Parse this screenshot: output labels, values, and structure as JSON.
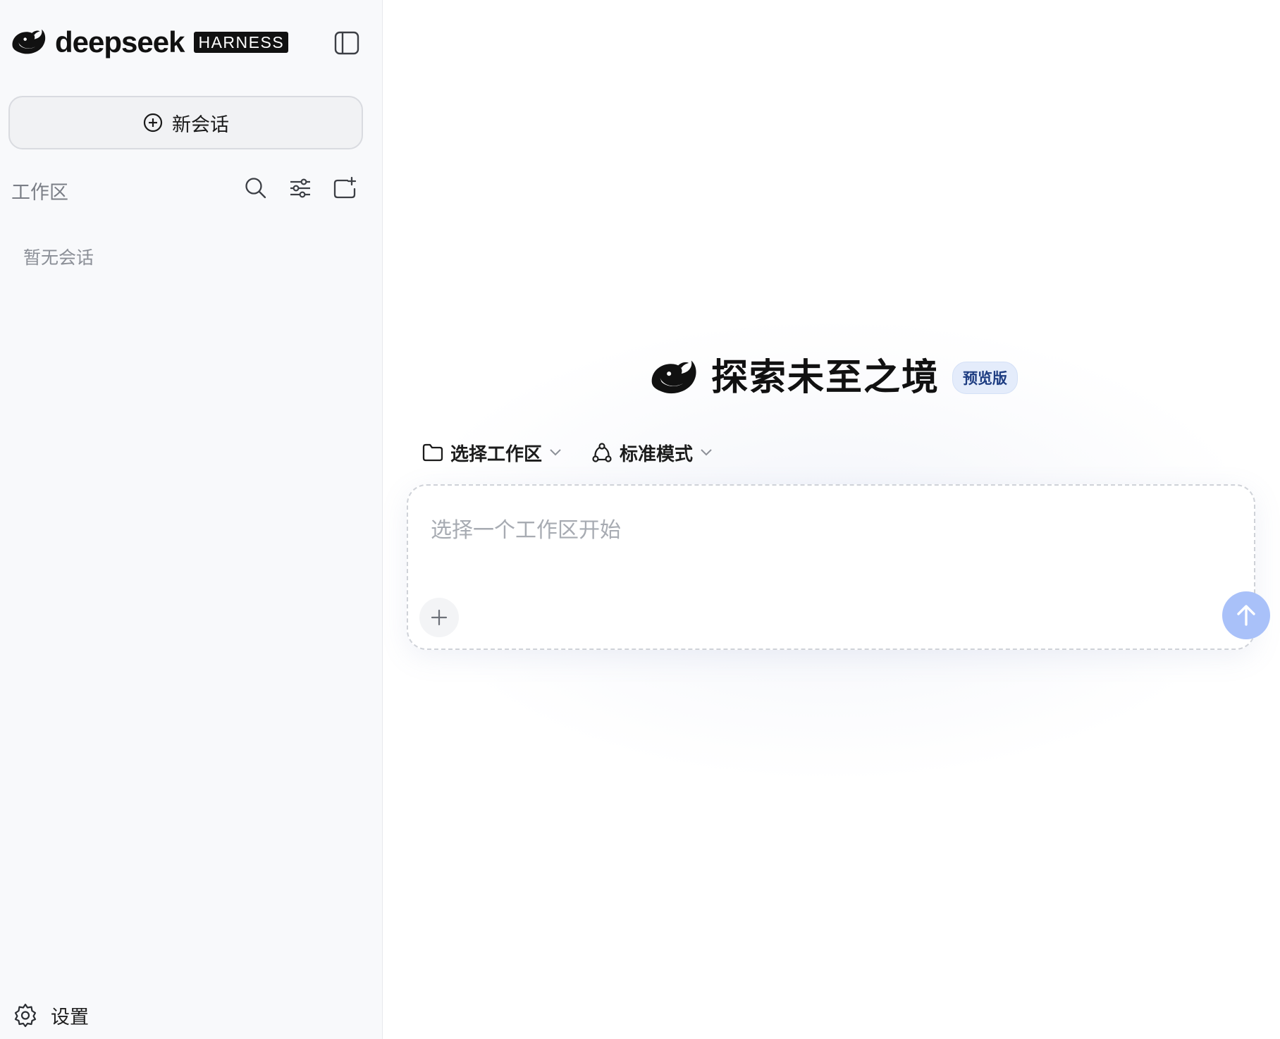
{
  "sidebar": {
    "logo_text": "deepseek",
    "logo_badge": "HARNESS",
    "new_chat_label": "新会话",
    "workspace_title": "工作区",
    "empty_sessions": "暂无会话",
    "settings_label": "设置"
  },
  "main": {
    "hero_title": "探索未至之境",
    "hero_badge": "预览版",
    "workspace_selector": "选择工作区",
    "mode_selector": "标准模式",
    "input_placeholder": "选择一个工作区开始"
  },
  "icons": {
    "logo": "whale-logo-icon",
    "collapse": "sidebar-toggle-icon",
    "new_chat": "plus-circle-icon",
    "search": "search-icon",
    "filter": "sliders-icon",
    "new_folder": "folder-plus-icon",
    "settings": "gear-icon",
    "folder": "folder-icon",
    "mode": "nodes-icon",
    "chevron": "chevron-down-icon",
    "attach": "plus-icon",
    "send": "arrow-up-icon"
  },
  "colors": {
    "sidebar_bg": "#f8f9fb",
    "badge_bg": "#e4ecfb",
    "badge_text": "#1e3d82",
    "send_button": "#a9c1f9",
    "text_primary": "#111111",
    "text_muted": "#8b8f97"
  }
}
